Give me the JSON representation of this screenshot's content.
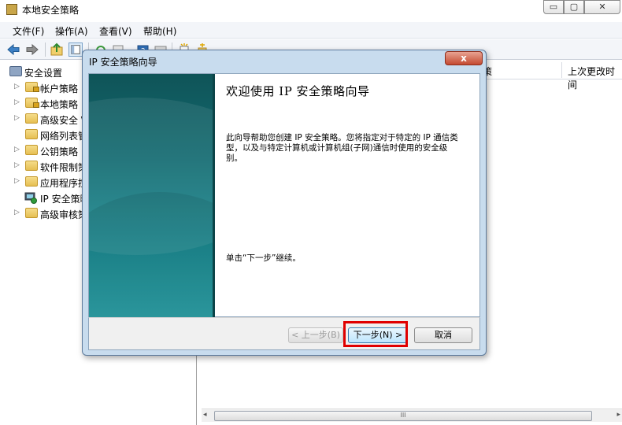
{
  "window": {
    "title": "本地安全策略",
    "minimize": "▭",
    "maximize": "▢",
    "close": "✕"
  },
  "menu": [
    "文件(F)",
    "操作(A)",
    "查看(V)",
    "帮助(H)"
  ],
  "tree": {
    "root": "安全设置",
    "items": [
      {
        "label": "帐户策略",
        "icon": "folder-lock-icon"
      },
      {
        "label": "本地策略",
        "icon": "folder-lock-icon"
      },
      {
        "label": "高级安全 \\",
        "icon": "folder-icon"
      },
      {
        "label": "网络列表管",
        "icon": "folder-icon"
      },
      {
        "label": "公钥策略",
        "icon": "folder-icon"
      },
      {
        "label": "软件限制策",
        "icon": "folder-icon"
      },
      {
        "label": "应用程序控",
        "icon": "folder-icon"
      },
      {
        "label": "IP 安全策略",
        "icon": "ip-security-icon"
      },
      {
        "label": "高级审核策",
        "icon": "folder-icon"
      }
    ]
  },
  "list": {
    "columns": [
      "策",
      "上次更改时间"
    ]
  },
  "scrollbar": {
    "left": "◂",
    "right": "▸",
    "grip": "III"
  },
  "dialog": {
    "title": "IP 安全策略向导",
    "close": "x",
    "heading": "欢迎使用 IP 安全策略向导",
    "description": "此向导帮助您创建 IP 安全策略。您将指定对于特定的 IP 通信类型，以及与特定计算机或计算机组(子网)通信时使用的安全级别。",
    "hint": "单击“下一步”继续。",
    "buttons": {
      "prev": "< 上一步(B)",
      "next": "下一步(N) >",
      "cancel": "取消"
    }
  }
}
